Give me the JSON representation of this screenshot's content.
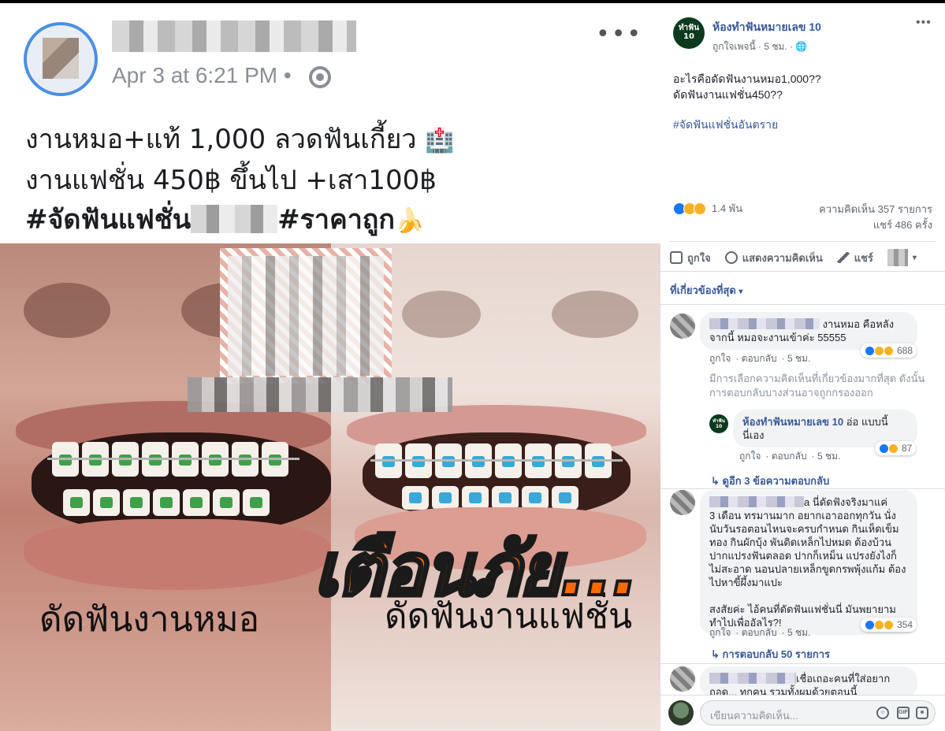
{
  "post": {
    "time": "Apr 3 at 6:21 PM •",
    "line1": "งานหมอ+แท้ 1,000 ลวดฟันเกี้ยว",
    "line1_emoji": "🏥",
    "line2": "งานแฟชั่น 450฿ ขึ้นไป +เสา100฿",
    "line3_a": "#จัดฟันแฟชั่น",
    "line3_b": "#ราคาถูก",
    "line3_emoji": "🍌"
  },
  "photo": {
    "left_label": "ดัดฟันงานหมอ",
    "right_label": "ดัดฟันงานแฟชั่น",
    "warning": "เตือนภัย...",
    "colors": {
      "warning": "#ff6a00",
      "brackets_left": "#3fa04a",
      "brackets_right": "#38a9d8"
    }
  },
  "sidebar": {
    "page_name": "ห้องทำฟันหมายเลข 10",
    "page_avatar_text": "ทำฟัน 10",
    "page_meta": "ถูกใจเพจนี้ · 5 ชม. · 🌐",
    "text_line1": "อะไรคือดัดฟันงานหมอ1,000??",
    "text_line2": "ดัดฟันงานแฟชั่น450??",
    "hashtag": "#จัดฟันแฟชั่นอันตราย",
    "reactions_count": "1.4 พัน",
    "comments_count": "ความคิดเห็น 357 รายการ",
    "shares_count": "แชร์ 486 ครั้ง",
    "actions": {
      "like": "ถูกใจ",
      "comment": "แสดงความคิดเห็น",
      "share": "แชร์"
    },
    "relevance": "ที่เกี่ยวข้องที่สุด",
    "relevance_caret": "▾",
    "comments": [
      {
        "text": "งานหมอ คือหลังจากนี้ หมอจะงานเข้าค่ะ 55555",
        "text_a": " งานหมอ คือหลัง",
        "text_b": "จากนี้ หมอจะงานเข้าค่ะ 55555",
        "like": "ถูกใจ",
        "reply": "ตอบกลับ",
        "time": "5 ชม.",
        "reactions": "688"
      },
      {
        "text_a": "a นี่ดัดฟังจริงมาแค่",
        "text_b": "3 เดือน ทรมานมาก อยากเอาออกทุกวัน นั่งนับวันรอตอนไหนจะครบกำหนด กินเห็ดเข็มทอง กินผักบุ้ง พันติดเหล็กไปหมด ต้องบ้วนปากแปรงฟันตลอด ปากก็เหม็น แปรงยังไงก็ไม่สะอาด นอนปลายเหล็กขูดกรพพุ้งแก้ม ต้องไปหาขี้ผึ้งมาแปะ",
        "text_c": "สงสัยค่ะ ไอ้คนที่ดัดฟันแฟชั่นนี่ มันพยายามทำไปเพื่ออัลไร?!",
        "like": "ถูกใจ",
        "reply": "ตอบกลับ",
        "time": "5 ชม.",
        "reactions": "354"
      },
      {
        "text_a": "เชื่อเถอะคนที่ใส่อยาก",
        "text_b": "ถอด... ทุกคน รวมทั้งผมด้วยตอนนี้"
      }
    ],
    "note": "มีการเลือกความคิดเห็นที่เกี่ยวข้องมากที่สุด ดังนั้นการตอบกลับบางส่วนอาจถูกกรองออก",
    "page_reply": {
      "name": "ห้องทำฟันหมายเลข 10",
      "text_a": " อ่อ แบบนี้",
      "text_b": "นี่เอง",
      "like": "ถูกใจ",
      "reply": "ตอบกลับ",
      "time": "5 ชม.",
      "reactions": "87"
    },
    "view_replies": "↳ ดูอีก 3 ข้อความตอบกลับ",
    "more_replies": "↳ การตอบกลับ 50 รายการ",
    "compose_placeholder": "เขียนความคิดเห็น...",
    "reaction_colors": {
      "like": "#1877f2",
      "haha": "#f7b125",
      "wow": "#f7b125"
    }
  }
}
